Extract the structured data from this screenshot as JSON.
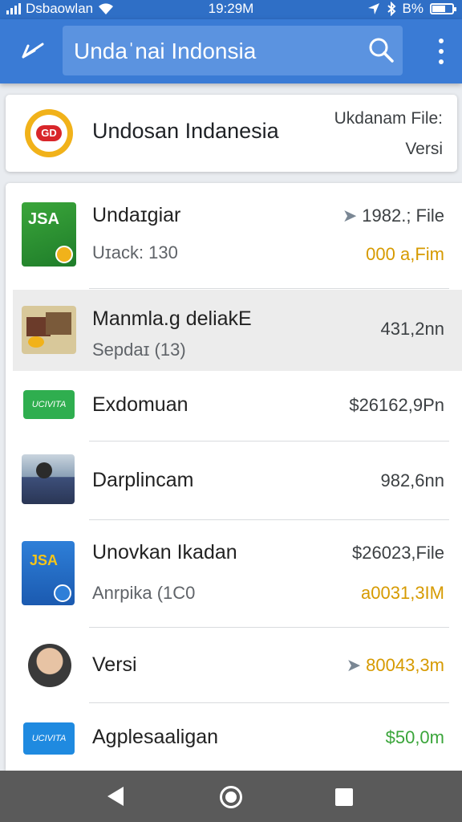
{
  "status_bar": {
    "carrier": "Dsbaowlan",
    "time": "19:29M",
    "battery": "B%"
  },
  "app_bar": {
    "search_text": "Undaˈnai Indonsia",
    "icons": [
      "back-arrow-icon",
      "search-icon",
      "more-vert-icon"
    ]
  },
  "header_card": {
    "title": "Undosan Indanesia",
    "meta_top": "Ukdanam File:",
    "meta_bottom": "Versi",
    "logo_text": "GD"
  },
  "list": {
    "items": [
      {
        "title": "Undaɪgiar",
        "subtitle": "Uɪack: 130",
        "right_top": "1982.; File",
        "right_bottom": "000 a,Fim",
        "right_bottom_color": "#d69a00",
        "starred": true,
        "icon_text": "JSA"
      },
      {
        "title": "Manmla.g deliakE",
        "subtitle": "Sepdaɪ (13)",
        "right_top": "431,2nn",
        "right_bottom": "",
        "right_bottom_color": "#3c4043",
        "starred": false,
        "icon_text": ""
      },
      {
        "title": "Exdomuan",
        "subtitle": "",
        "right_top": "$26162,9Pn",
        "right_bottom": "",
        "right_bottom_color": "#3c4043",
        "starred": false,
        "icon_text": "UCIVITA"
      },
      {
        "title": "Darplincam",
        "subtitle": "",
        "right_top": "982,6nn",
        "right_bottom": "",
        "right_bottom_color": "#3c4043",
        "starred": false,
        "icon_text": ""
      },
      {
        "title": "Unovkan Ikadan",
        "subtitle": "Anrpika (1C0",
        "right_top": "$26023,File",
        "right_bottom": "a0031,3IM",
        "right_bottom_color": "#d69a00",
        "starred": false,
        "icon_text": "JSA"
      },
      {
        "title": "Versi",
        "subtitle": "",
        "right_top": "80043,3m",
        "right_bottom": "",
        "right_bottom_color": "#d69a00",
        "starred": true,
        "icon_text": ""
      },
      {
        "title": "Agplesaaligan",
        "subtitle": "",
        "right_top": "$50,0m",
        "right_bottom": "",
        "right_bottom_color": "#3aa53a",
        "starred": false,
        "icon_text": "UCIVITA"
      }
    ]
  },
  "nav_bar": {
    "icons": [
      "nav-back-icon",
      "nav-home-icon",
      "nav-recents-icon"
    ]
  }
}
